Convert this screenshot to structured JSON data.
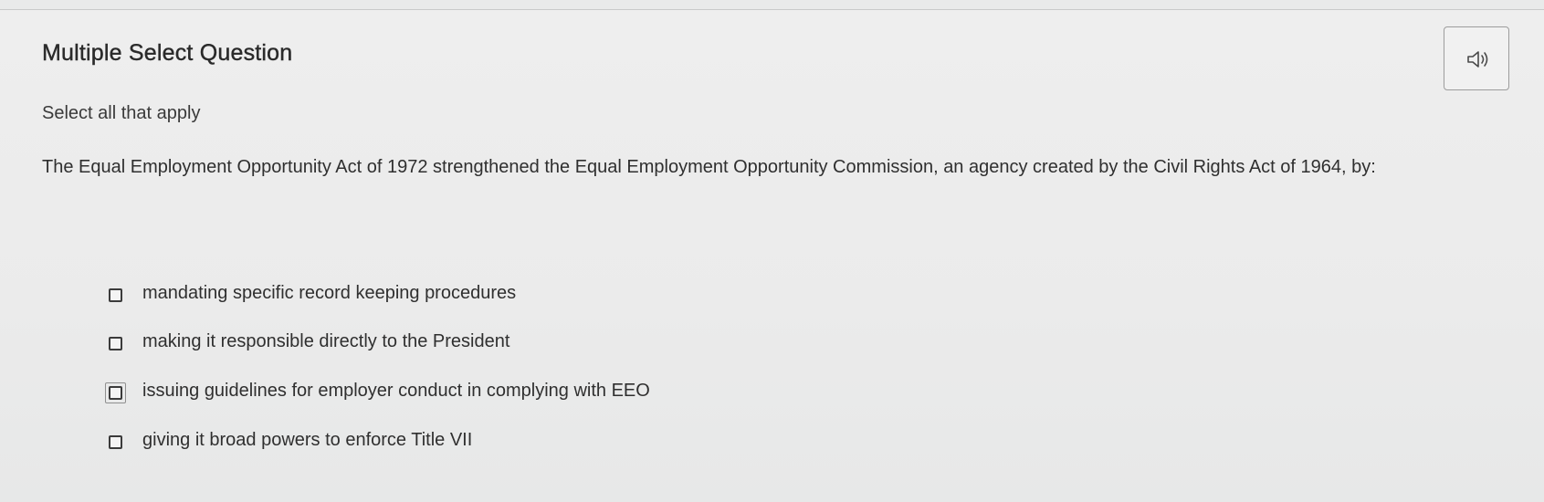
{
  "question": {
    "title": "Multiple Select Question",
    "instruction": "Select all that apply",
    "prompt": "The Equal Employment Opportunity Act of 1972 strengthened the Equal Employment Opportunity Commission, an agency created by the Civil Rights Act of 1964, by:",
    "audio_icon": "speaker-icon",
    "options": [
      {
        "label": "mandating specific record keeping procedures",
        "checked": false,
        "focused": false
      },
      {
        "label": "making it responsible directly to the President",
        "checked": false,
        "focused": false
      },
      {
        "label": "issuing guidelines for employer conduct in complying with EEO",
        "checked": false,
        "focused": true
      },
      {
        "label": "giving it broad powers to enforce Title VII",
        "checked": false,
        "focused": false
      }
    ]
  },
  "colors": {
    "background": "#ebebeb",
    "text": "#2f2f2f",
    "checkbox_border": "#3b3b3b",
    "button_border": "#9c9c9c"
  }
}
